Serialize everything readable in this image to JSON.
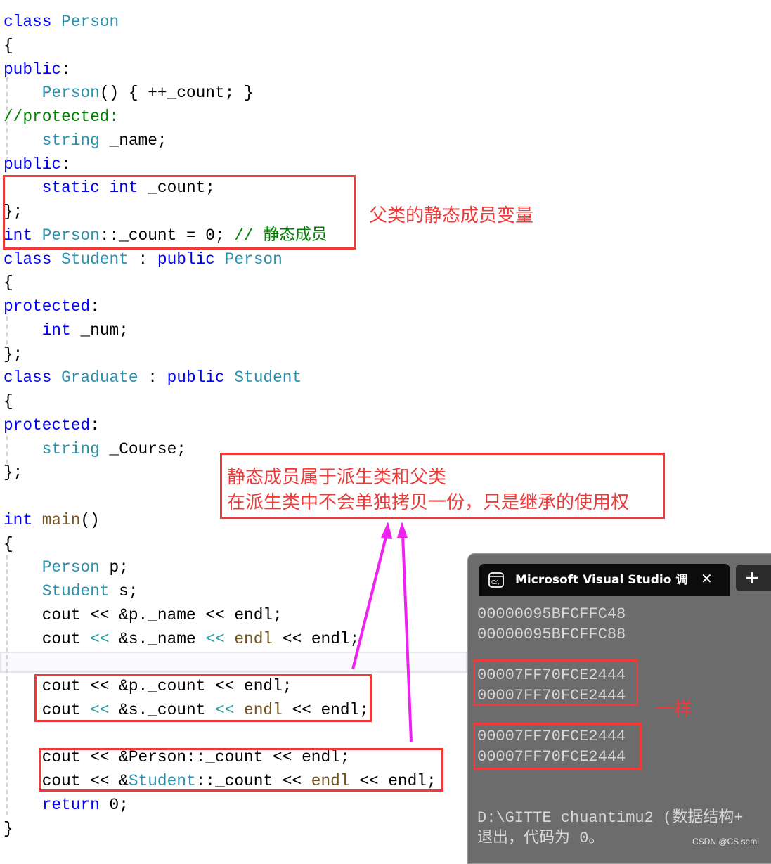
{
  "code_lines": [
    [
      [
        "class ",
        "k"
      ],
      [
        "Person",
        "t"
      ]
    ],
    [
      [
        "{",
        "n"
      ]
    ],
    [
      [
        "public",
        "k"
      ],
      [
        ":",
        "n"
      ]
    ],
    [
      [
        "    ",
        "n"
      ],
      [
        "Person",
        "t"
      ],
      [
        "() { ++_count; }",
        "n"
      ]
    ],
    [
      [
        "//protected:",
        "c"
      ]
    ],
    [
      [
        "    ",
        "n"
      ],
      [
        "string",
        "t"
      ],
      [
        " _name;",
        "n"
      ]
    ],
    [
      [
        "public",
        "k"
      ],
      [
        ":",
        "n"
      ]
    ],
    [
      [
        "    ",
        "n"
      ],
      [
        "static int",
        "k"
      ],
      [
        " _count;",
        "n"
      ]
    ],
    [
      [
        "};",
        "n"
      ]
    ],
    [
      [
        "int ",
        "k"
      ],
      [
        "Person",
        "t"
      ],
      [
        "::_count = 0; ",
        "n"
      ],
      [
        "// 静态成员",
        "c"
      ]
    ],
    [
      [
        "class ",
        "k"
      ],
      [
        "Student",
        "t"
      ],
      [
        " : ",
        "n"
      ],
      [
        "public ",
        "k"
      ],
      [
        "Person",
        "t"
      ]
    ],
    [
      [
        "{",
        "n"
      ]
    ],
    [
      [
        "protected",
        "k"
      ],
      [
        ":",
        "n"
      ]
    ],
    [
      [
        "    ",
        "n"
      ],
      [
        "int",
        "k"
      ],
      [
        " _num;",
        "n"
      ]
    ],
    [
      [
        "};",
        "n"
      ]
    ],
    [
      [
        "class ",
        "k"
      ],
      [
        "Graduate",
        "t"
      ],
      [
        " : ",
        "n"
      ],
      [
        "public ",
        "k"
      ],
      [
        "Student",
        "t"
      ]
    ],
    [
      [
        "{",
        "n"
      ]
    ],
    [
      [
        "protected",
        "k"
      ],
      [
        ":",
        "n"
      ]
    ],
    [
      [
        "    ",
        "n"
      ],
      [
        "string",
        "t"
      ],
      [
        " _Course;",
        "n"
      ]
    ],
    [
      [
        "};",
        "n"
      ]
    ],
    [],
    [
      [
        "int ",
        "k"
      ],
      [
        "main",
        "f"
      ],
      [
        "()",
        "n"
      ]
    ],
    [
      [
        "{",
        "n"
      ]
    ],
    [
      [
        "    ",
        "n"
      ],
      [
        "Person",
        "t"
      ],
      [
        " p;",
        "n"
      ]
    ],
    [
      [
        "    ",
        "n"
      ],
      [
        "Student",
        "t"
      ],
      [
        " s;",
        "n"
      ]
    ],
    [
      [
        "    cout << &p._name << endl;",
        "n"
      ]
    ],
    [
      [
        "    cout ",
        "n"
      ],
      [
        "<<",
        "o"
      ],
      [
        " &s._name ",
        "n"
      ],
      [
        "<<",
        "o"
      ],
      [
        " ",
        "n"
      ],
      [
        "endl",
        "f"
      ],
      [
        " << endl;",
        "n"
      ]
    ],
    [],
    [
      [
        "    cout << &p._count << endl;",
        "n"
      ]
    ],
    [
      [
        "    cout ",
        "n"
      ],
      [
        "<<",
        "o"
      ],
      [
        " &s._count ",
        "n"
      ],
      [
        "<<",
        "o"
      ],
      [
        " ",
        "n"
      ],
      [
        "endl",
        "f"
      ],
      [
        " << endl;",
        "n"
      ]
    ],
    [],
    [
      [
        "    cout << &Person::_count << endl;",
        "n"
      ]
    ],
    [
      [
        "    cout << &",
        "n"
      ],
      [
        "Student",
        "t"
      ],
      [
        "::_count << ",
        "n"
      ],
      [
        "endl",
        "f"
      ],
      [
        " << endl;",
        "n"
      ]
    ],
    [
      [
        "    ",
        "n"
      ],
      [
        "return",
        "k"
      ],
      [
        " 0;",
        "n"
      ]
    ],
    [
      [
        "}",
        "n"
      ]
    ]
  ],
  "annotations": {
    "parent_static": "父类的静态成员变量",
    "shared_line1": "静态成员属于派生类和父类",
    "shared_line2": "在派生类中不会单独拷贝一份，只是继承的使用权",
    "same": "一样"
  },
  "terminal": {
    "tab_title": "Microsoft Visual Studio 调试控制台",
    "tab_icon": "console-icon",
    "close_icon": "close-icon",
    "new_tab_icon": "plus-icon",
    "close_glyph": "✕",
    "plus_glyph": "+",
    "lines": [
      "00000095BFCFFC48",
      "00000095BFCFFC88",
      "",
      "00007FF70FCE2444",
      "00007FF70FCE2444",
      "",
      "00007FF70FCE2444",
      "00007FF70FCE2444",
      "",
      "",
      "D:\\GITTE chuantimu2 (数据结构+",
      "退出，代码为 0。"
    ]
  },
  "watermark": "CSDN @CS semi",
  "colors": {
    "keyword": "#0000ff",
    "type": "#2b91af",
    "comment": "#008000",
    "annotation": "#f03a3a",
    "arrow": "#ee22ee",
    "terminal_bg": "#6c6c6c"
  }
}
